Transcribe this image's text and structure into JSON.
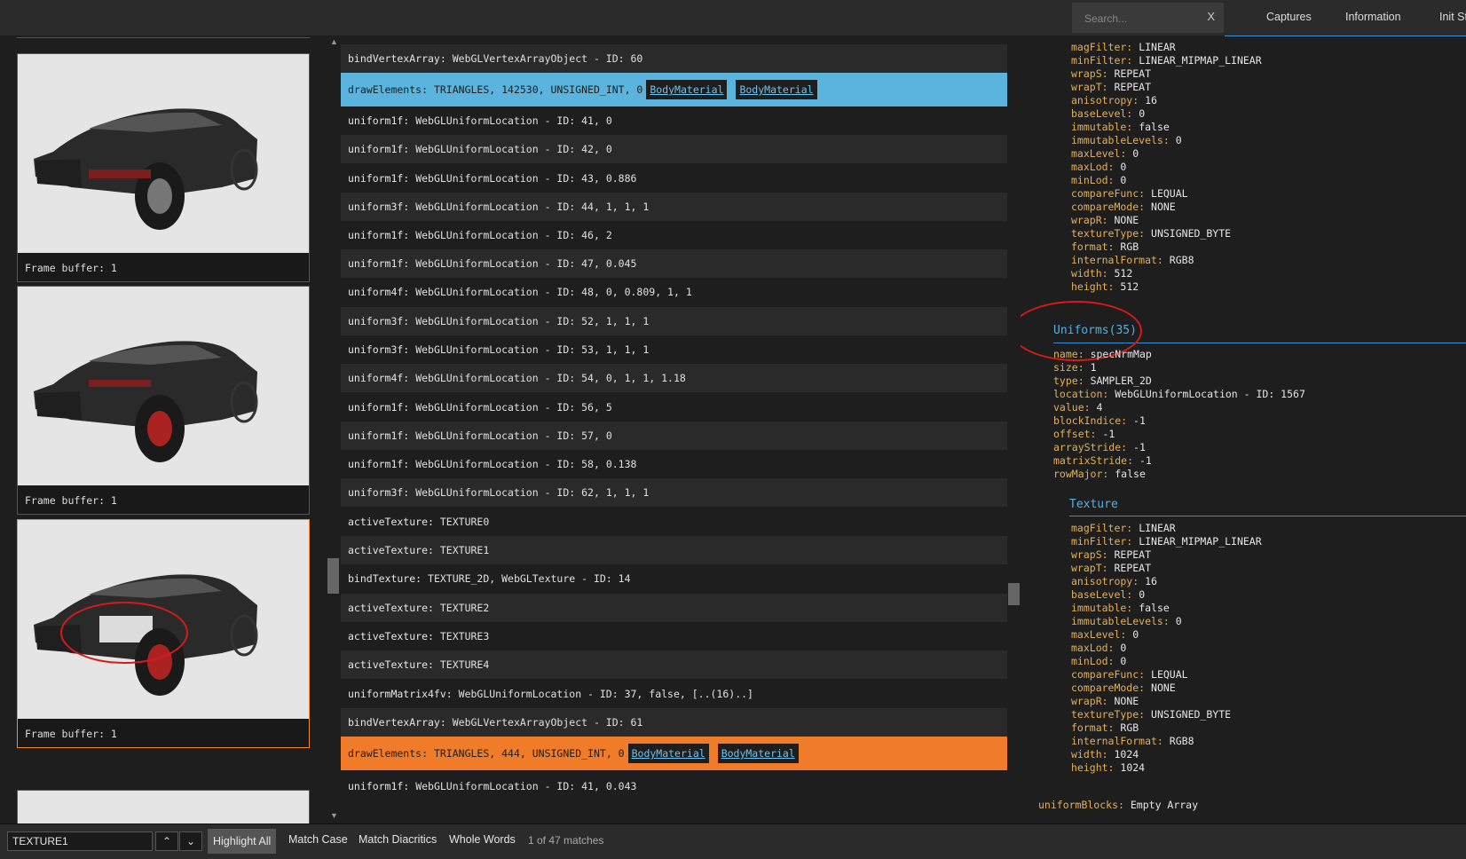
{
  "topbar": {
    "search_placeholder": "Search...",
    "clear_label": "X",
    "tabs": [
      "Captures",
      "Information",
      "Init St"
    ]
  },
  "thumbnails": [
    {
      "label": "Frame buffer: 1"
    },
    {
      "label": "Frame buffer: 1"
    },
    {
      "label": "Frame buffer: 1"
    }
  ],
  "commands": [
    {
      "name": "bindVertexArray:",
      "args": "WebGLVertexArrayObject - ID: 60"
    },
    {
      "name": "drawElements:",
      "args": "TRIANGLES, 142530, UNSIGNED_INT, 0",
      "links": [
        "BodyMaterial",
        "BodyMaterial"
      ]
    },
    {
      "name": "uniform1f:",
      "args": "WebGLUniformLocation - ID: 41, 0"
    },
    {
      "name": "uniform1f:",
      "args": "WebGLUniformLocation - ID: 42, 0"
    },
    {
      "name": "uniform1f:",
      "args": "WebGLUniformLocation - ID: 43, 0.886"
    },
    {
      "name": "uniform3f:",
      "args": "WebGLUniformLocation - ID: 44, 1, 1, 1"
    },
    {
      "name": "uniform1f:",
      "args": "WebGLUniformLocation - ID: 46, 2"
    },
    {
      "name": "uniform1f:",
      "args": "WebGLUniformLocation - ID: 47, 0.045"
    },
    {
      "name": "uniform4f:",
      "args": "WebGLUniformLocation - ID: 48, 0, 0.809, 1, 1"
    },
    {
      "name": "uniform3f:",
      "args": "WebGLUniformLocation - ID: 52, 1, 1, 1"
    },
    {
      "name": "uniform3f:",
      "args": "WebGLUniformLocation - ID: 53, 1, 1, 1"
    },
    {
      "name": "uniform4f:",
      "args": "WebGLUniformLocation - ID: 54, 0, 1, 1, 1.18"
    },
    {
      "name": "uniform1f:",
      "args": "WebGLUniformLocation - ID: 56, 5"
    },
    {
      "name": "uniform1f:",
      "args": "WebGLUniformLocation - ID: 57, 0"
    },
    {
      "name": "uniform1f:",
      "args": "WebGLUniformLocation - ID: 58, 0.138"
    },
    {
      "name": "uniform3f:",
      "args": "WebGLUniformLocation - ID: 62, 1, 1, 1"
    },
    {
      "name": "activeTexture:",
      "args": "TEXTURE0"
    },
    {
      "name": "activeTexture:",
      "args": "TEXTURE1"
    },
    {
      "name": "bindTexture:",
      "args": "TEXTURE_2D, WebGLTexture - ID: 14"
    },
    {
      "name": "activeTexture:",
      "args": "TEXTURE2"
    },
    {
      "name": "activeTexture:",
      "args": "TEXTURE3"
    },
    {
      "name": "activeTexture:",
      "args": "TEXTURE4"
    },
    {
      "name": "uniformMatrix4fv:",
      "args": "WebGLUniformLocation - ID: 37, false, [..(16)..]"
    },
    {
      "name": "bindVertexArray:",
      "args": "WebGLVertexArrayObject - ID: 61"
    },
    {
      "name": "drawElements:",
      "args": "TRIANGLES, 444, UNSIGNED_INT, 0",
      "links": [
        "BodyMaterial",
        "BodyMaterial"
      ]
    },
    {
      "name": "uniform1f:",
      "args": "WebGLUniformLocation - ID: 41, 0.043"
    }
  ],
  "detail": {
    "texture_top": [
      {
        "k": "magFilter:",
        "v": "LINEAR"
      },
      {
        "k": "minFilter:",
        "v": "LINEAR_MIPMAP_LINEAR"
      },
      {
        "k": "wrapS:",
        "v": "REPEAT"
      },
      {
        "k": "wrapT:",
        "v": "REPEAT"
      },
      {
        "k": "anisotropy:",
        "v": "16"
      },
      {
        "k": "baseLevel:",
        "v": "0"
      },
      {
        "k": "immutable:",
        "v": "false"
      },
      {
        "k": "immutableLevels:",
        "v": "0"
      },
      {
        "k": "maxLevel:",
        "v": "0"
      },
      {
        "k": "maxLod:",
        "v": "0"
      },
      {
        "k": "minLod:",
        "v": "0"
      },
      {
        "k": "compareFunc:",
        "v": "LEQUAL"
      },
      {
        "k": "compareMode:",
        "v": "NONE"
      },
      {
        "k": "wrapR:",
        "v": "NONE"
      },
      {
        "k": "textureType:",
        "v": "UNSIGNED_BYTE"
      },
      {
        "k": "format:",
        "v": "RGB"
      },
      {
        "k": "internalFormat:",
        "v": "RGB8"
      },
      {
        "k": "width:",
        "v": "512"
      },
      {
        "k": "height:",
        "v": "512"
      }
    ],
    "uniforms_title": "Uniforms(35)",
    "uniform": [
      {
        "k": "name:",
        "v": "specNrmMap"
      },
      {
        "k": "size:",
        "v": "1"
      },
      {
        "k": "type:",
        "v": "SAMPLER_2D"
      },
      {
        "k": "location:",
        "v": "WebGLUniformLocation - ID: 1567"
      },
      {
        "k": "value:",
        "v": "4"
      },
      {
        "k": "blockIndice:",
        "v": "-1"
      },
      {
        "k": "offset:",
        "v": "-1"
      },
      {
        "k": "arrayStride:",
        "v": "-1"
      },
      {
        "k": "matrixStride:",
        "v": "-1"
      },
      {
        "k": "rowMajor:",
        "v": "false"
      }
    ],
    "texture_title": "Texture",
    "texture": [
      {
        "k": "magFilter:",
        "v": "LINEAR"
      },
      {
        "k": "minFilter:",
        "v": "LINEAR_MIPMAP_LINEAR"
      },
      {
        "k": "wrapS:",
        "v": "REPEAT"
      },
      {
        "k": "wrapT:",
        "v": "REPEAT"
      },
      {
        "k": "anisotropy:",
        "v": "16"
      },
      {
        "k": "baseLevel:",
        "v": "0"
      },
      {
        "k": "immutable:",
        "v": "false"
      },
      {
        "k": "immutableLevels:",
        "v": "0"
      },
      {
        "k": "maxLevel:",
        "v": "0"
      },
      {
        "k": "maxLod:",
        "v": "0"
      },
      {
        "k": "minLod:",
        "v": "0"
      },
      {
        "k": "compareFunc:",
        "v": "LEQUAL"
      },
      {
        "k": "compareMode:",
        "v": "NONE"
      },
      {
        "k": "wrapR:",
        "v": "NONE"
      },
      {
        "k": "textureType:",
        "v": "UNSIGNED_BYTE"
      },
      {
        "k": "format:",
        "v": "RGB"
      },
      {
        "k": "internalFormat:",
        "v": "RGB8"
      },
      {
        "k": "width:",
        "v": "1024"
      },
      {
        "k": "height:",
        "v": "1024"
      }
    ],
    "uniform_blocks": {
      "k": "uniformBlocks:",
      "v": "Empty Array"
    }
  },
  "findbar": {
    "value": "TEXTURE1",
    "up_icon": "chevron-up-icon",
    "down_icon": "chevron-down-icon",
    "highlight_all": "Highlight All",
    "match_case": "Match Case",
    "match_diacritics": "Match Diacritics",
    "whole_words": "Whole Words",
    "match_count": "1 of 47 matches"
  },
  "colors": {
    "highlight_blue": "#5ab4dd",
    "highlight_orange": "#f07b29",
    "key": "#e3b15a",
    "section": "#4fb3e6",
    "annotation": "#d61a1a"
  }
}
